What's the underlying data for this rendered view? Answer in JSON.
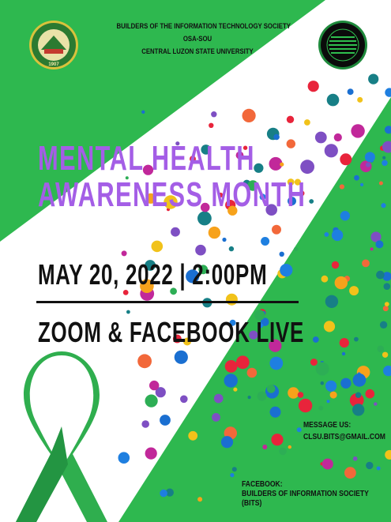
{
  "header": {
    "line1": "BUILDERS OF THE INFORMATION TECHNOLOGY SOCIETY",
    "line2": "OSA-SOU",
    "line3": "CENTRAL LUZON STATE UNIVERSITY"
  },
  "left_logo": {
    "icon": "university-seal-icon",
    "ring_text": "CENTRAL LUZON STATE UNIVERSITY",
    "year": "1907"
  },
  "right_logo": {
    "icon": "bits-logo-icon"
  },
  "title": {
    "line1": "MENTAL HEALTH",
    "line2": "AWARENESS MONTH"
  },
  "event": {
    "datetime": "MAY 20, 2022 | 2:00PM",
    "venue": "ZOOM & FACEBOOK LIVE"
  },
  "contact": {
    "message_label": "MESSAGE US:",
    "email": "CLSU.BITS@GMAIL.COM",
    "facebook_label": "FACEBOOK:",
    "facebook_page_line1": "BUILDERS OF INFORMATION SOCIETY",
    "facebook_page_line2": "(BITS)"
  },
  "colors": {
    "green": "#2eb84f",
    "title_purple": "#a45ee6",
    "ribbon_green": "#2fae4e",
    "dots": [
      "#e8243b",
      "#1e7fe0",
      "#f2683a",
      "#1a6fd1",
      "#c1289a",
      "#2dae55",
      "#f7a21b",
      "#177f86",
      "#7e4fc3",
      "#f1c21a"
    ]
  }
}
